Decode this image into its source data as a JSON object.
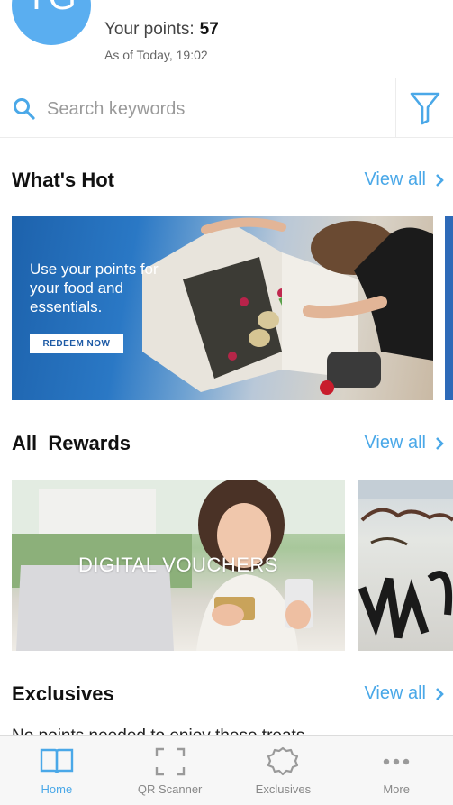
{
  "header": {
    "avatar_initials": "TG",
    "points_label": "Your points:",
    "points_value": "57",
    "points_date": "As of Today, 19:02"
  },
  "search": {
    "placeholder": "Search keywords"
  },
  "sections": {
    "hot": {
      "title": "What's Hot",
      "view_all": "View all"
    },
    "rewards": {
      "title": "All  Rewards",
      "view_all": "View all"
    },
    "exclusives": {
      "title": "Exclusives",
      "view_all": "View all",
      "subtitle": "No points needed to enjoy these treats"
    }
  },
  "hot_banner": {
    "text": "Use your points for your food and essentials.",
    "button": "REDEEM NOW"
  },
  "reward_cards": [
    {
      "label": "DIGITAL VOUCHERS"
    }
  ],
  "bottom_nav": [
    {
      "label": "Home",
      "icon": "book-icon",
      "active": true
    },
    {
      "label": "QR Scanner",
      "icon": "qr-scan-icon",
      "active": false
    },
    {
      "label": "Exclusives",
      "icon": "badge-icon",
      "active": false
    },
    {
      "label": "More",
      "icon": "more-dots-icon",
      "active": false
    }
  ],
  "colors": {
    "accent": "#4aa8e8",
    "avatar": "#5aaef0",
    "banner_blue": "#1d62ac"
  }
}
